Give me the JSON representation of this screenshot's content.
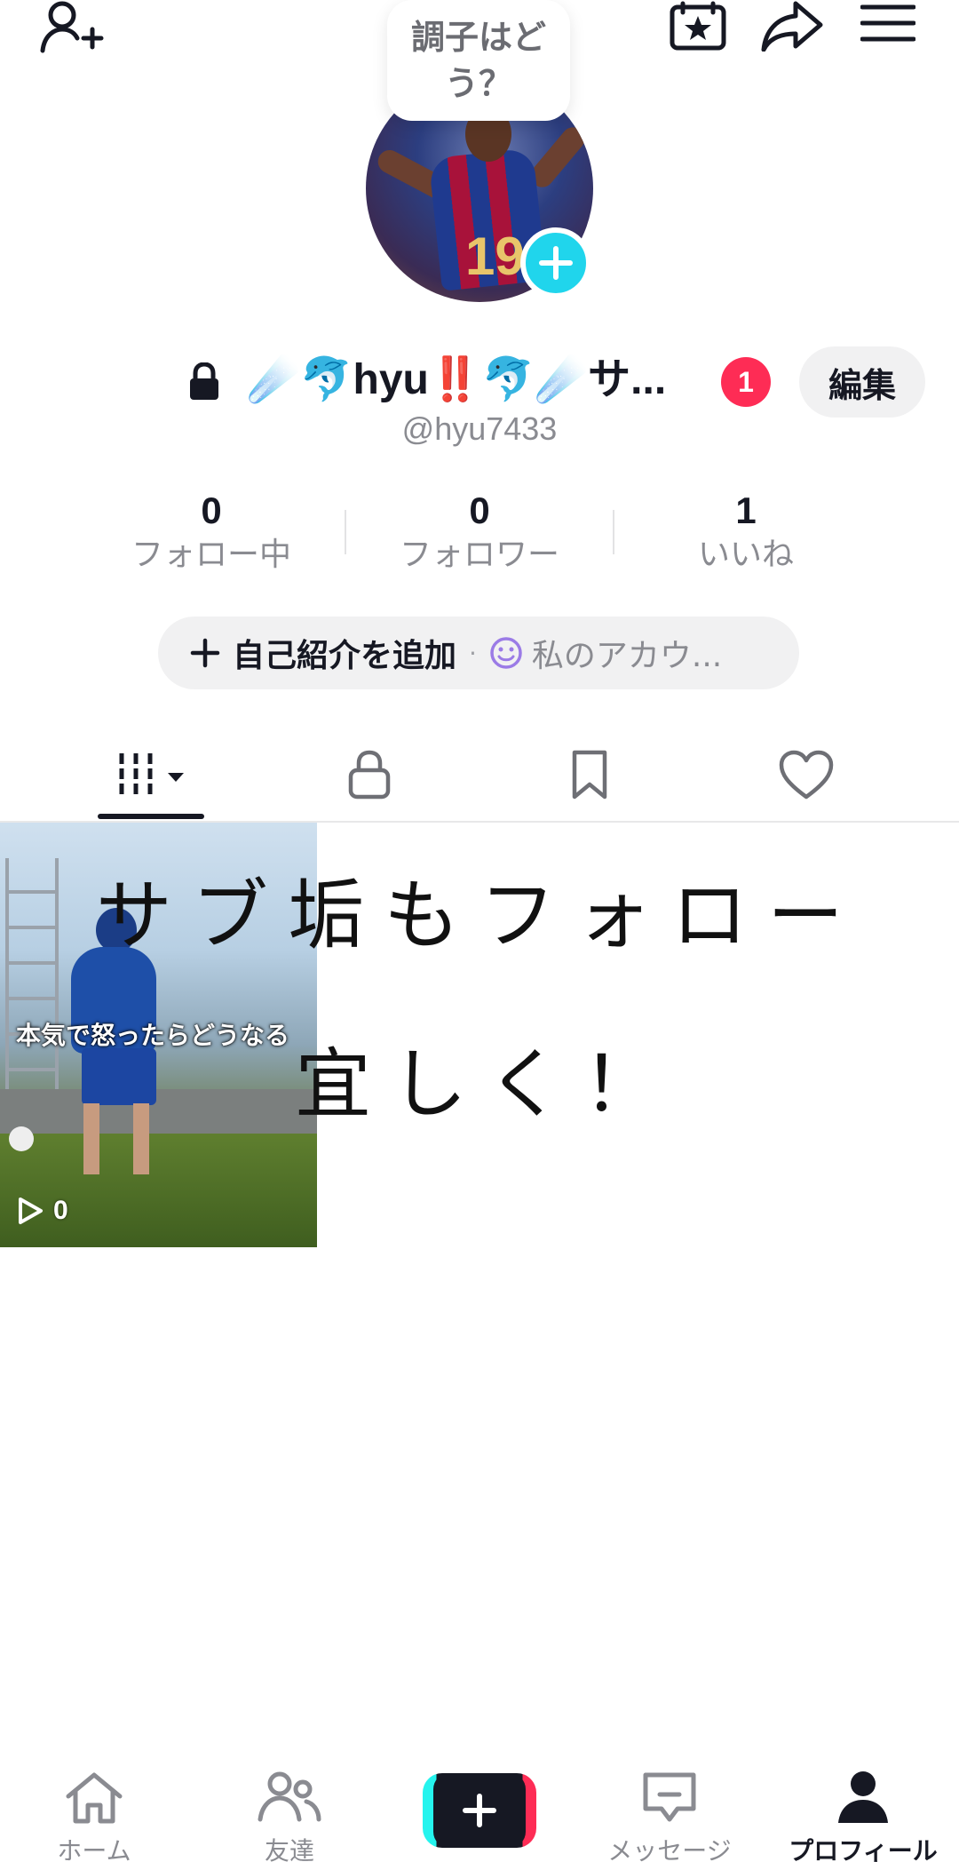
{
  "mood_prompt": "調子はどう？",
  "profile": {
    "display_name": "☄️🐬hyu‼️🐬☄️サ...",
    "username": "@hyu7433",
    "notification_count": "1",
    "edit_label": "編集"
  },
  "stats": [
    {
      "value": "0",
      "label": "フォロー中"
    },
    {
      "value": "0",
      "label": "フォロワー"
    },
    {
      "value": "1",
      "label": "いいね"
    }
  ],
  "bio": {
    "add_label": "自己紹介を追加",
    "separator": "·",
    "account_label": "私のアカウ..."
  },
  "tabs": [
    {
      "name": "videos",
      "icon": "grid-icon",
      "active": true
    },
    {
      "name": "private",
      "icon": "lock-icon"
    },
    {
      "name": "saved",
      "icon": "bookmark-icon"
    },
    {
      "name": "liked",
      "icon": "heart-icon"
    }
  ],
  "videos": [
    {
      "caption": "本気で怒ったらどうなる",
      "views": "0"
    }
  ],
  "overlay_text": {
    "line1": "サブ垢もフォロー",
    "line2": "宜しく！"
  },
  "bottom_nav": [
    {
      "label": "ホーム",
      "icon": "home-icon"
    },
    {
      "label": "友達",
      "icon": "friends-icon"
    },
    {
      "label": "",
      "icon": "create-plus-icon"
    },
    {
      "label": "メッセージ",
      "icon": "message-icon"
    },
    {
      "label": "プロフィール",
      "icon": "profile-icon",
      "active": true
    }
  ],
  "colors": {
    "accent_cyan": "#20d5ec",
    "badge_red": "#fe2c55",
    "text_primary": "#161823",
    "text_secondary": "#8a8b91"
  }
}
